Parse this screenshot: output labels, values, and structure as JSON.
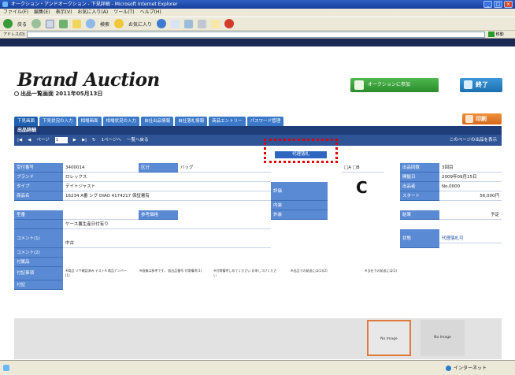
{
  "window": {
    "title": "オークション・アンドオークション - 下見詳細 - Microsoft Internet Explorer",
    "min": "_",
    "max": "□",
    "close": "×"
  },
  "menu": [
    "ファイル(F)",
    "編集(E)",
    "表示(V)",
    "お気に入り(A)",
    "ツール(T)",
    "ヘルプ(H)"
  ],
  "toolbar": {
    "back": "戻る",
    "search": "検索",
    "favorites": "お気に入り"
  },
  "address": {
    "label": "アドレス(D)",
    "go": "移動"
  },
  "header": {
    "logo": "Brand Auction",
    "subtitle": "出品一覧画面 2011年05月13日",
    "action_button": "オークションに参加",
    "exit_button": "終了"
  },
  "tabs": [
    "下見画面",
    "下見状況の入力",
    "相場画面",
    "相場状況の入力",
    "自社出品情報",
    "自社落札情報",
    "商品エントリー",
    "パスワード管理"
  ],
  "print_button": "印刷",
  "section_title": "出品詳細",
  "nav": {
    "first": "|◀",
    "prev": "◀",
    "page_label": "ページ",
    "page_value": "1",
    "next": "▶",
    "last": "▶|",
    "refresh": "↻",
    "list": "1ページへ",
    "all": "一覧へ戻る",
    "right": "このページの出品を表示"
  },
  "center_button": "代理落札",
  "annotation_letter": "C",
  "fields": {
    "r1": {
      "l1": "受付番号",
      "v1": "3400014",
      "l2": "区分",
      "v2": "バッグ",
      "l3": "",
      "v3": "□A □B",
      "l4": "出品回数",
      "v4": "3回目"
    },
    "r2": {
      "l1": "ブランド",
      "v1": "ロレックス",
      "l4": "開催日",
      "v4": "2009年09月15日"
    },
    "r3": {
      "l1": "タイプ",
      "v1": "デイトジャスト",
      "l3": "評価",
      "l4": "出品者",
      "v4": "No.0000"
    },
    "r4": {
      "l1": "商品名",
      "v1": "16234 A番 シグ DIAO 4174217 保証書有",
      "l3": "内装",
      "l4": "スタート",
      "v4": "56,000円"
    },
    "r5": {
      "l1": "型番",
      "l2": "参考価格",
      "l3": "外装",
      "l4": "結果",
      "v4": "予定"
    },
    "r6": {
      "l1": "",
      "v1": "ケース裏生産日付有り"
    },
    "r7": {
      "l1": "コメント(1)",
      "v1": "中古",
      "l4": "状態",
      "v4": "代理落札可"
    },
    "r8": {
      "l1": "コメント(2)"
    },
    "r9": {
      "l1": "付属品"
    },
    "r10": {
      "l1": "付記事項",
      "notes": [
        "※商品 リサ確認済み テストA 商品ナンバー(1)",
        "※画像は参考です。 仮出品番号 付帯備考(1)",
        "※付帯備考しめてください お申しつけください",
        "※出品での発送には(1)(2)",
        "※当社での発送には(1)"
      ]
    },
    "r11": {
      "l1": "付記"
    }
  },
  "images": {
    "left": "No Image",
    "right": "No Image"
  },
  "status": {
    "zone": "インターネット"
  }
}
